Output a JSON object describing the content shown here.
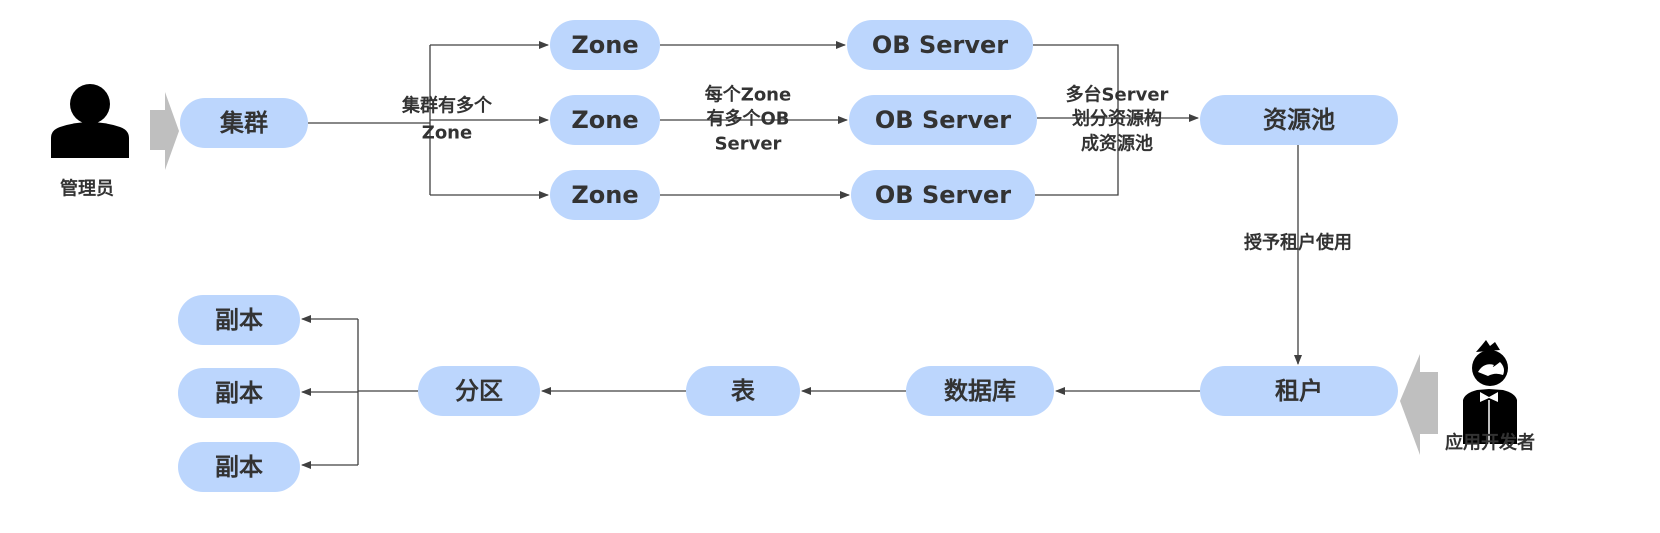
{
  "colors": {
    "node_fill": "#bcd6fd",
    "text": "#333333",
    "connector": "#404040",
    "role_arrow": "#bfbfbf"
  },
  "actors": {
    "admin": {
      "label": "管理员",
      "icon": "person-icon"
    },
    "developer": {
      "label": "应用开发者",
      "icon": "developer-icon"
    }
  },
  "nodes": {
    "cluster": "集群",
    "zones": [
      "Zone",
      "Zone",
      "Zone"
    ],
    "servers": [
      "OB Server",
      "OB Server",
      "OB Server"
    ],
    "resource_pool": "资源池",
    "tenant": "租户",
    "database": "数据库",
    "table": "表",
    "partition": "分区",
    "replicas": [
      "副本",
      "副本",
      "副本"
    ]
  },
  "annotations": {
    "cluster_zone": [
      "集群有多个",
      "Zone"
    ],
    "zone_server": [
      "每个Zone",
      "有多个OB",
      "Server"
    ],
    "server_pool": [
      "多台Server",
      "划分资源构",
      "成资源池"
    ],
    "pool_tenant": "授予租户使用"
  }
}
